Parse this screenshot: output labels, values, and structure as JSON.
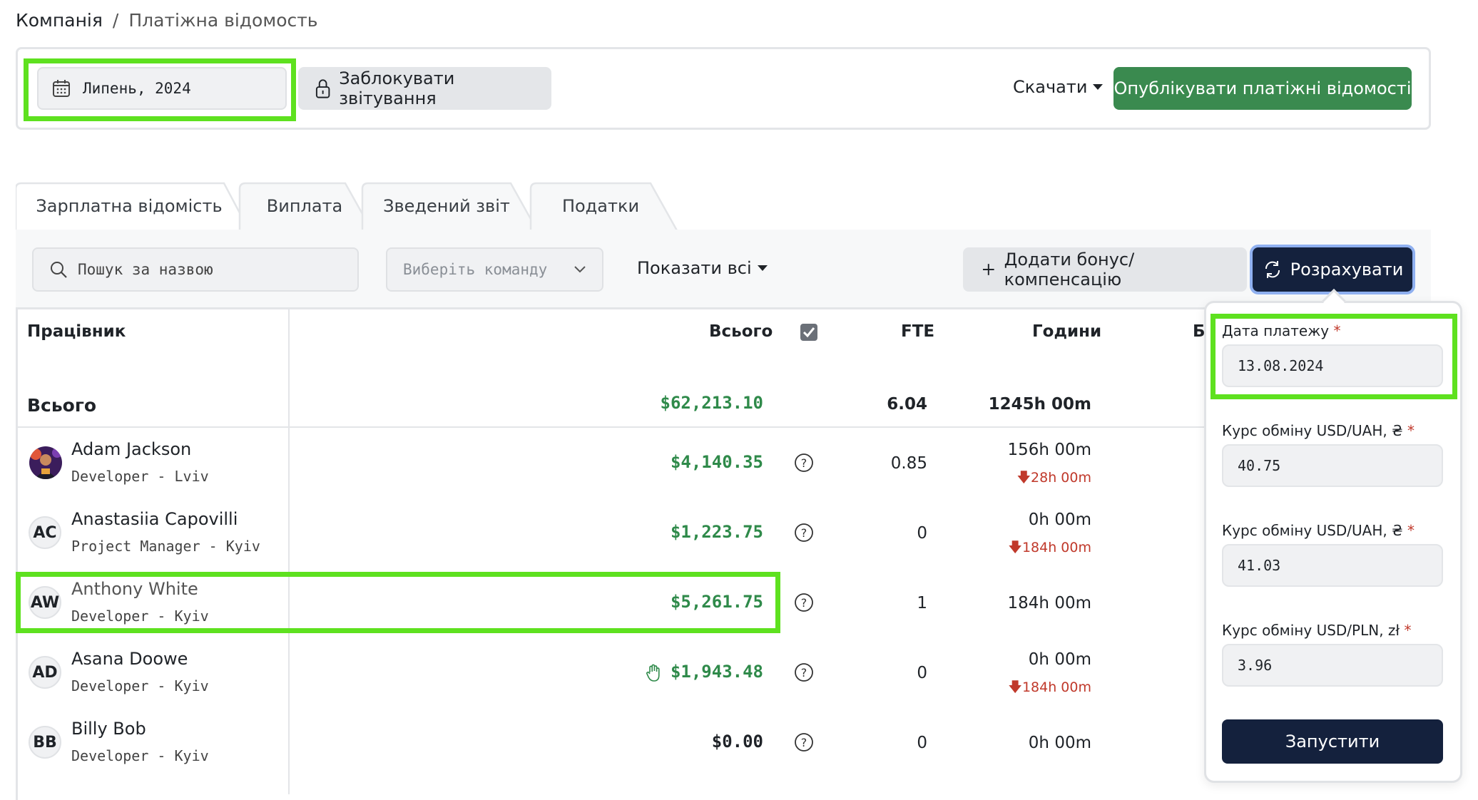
{
  "breadcrumb": {
    "root": "Компанія",
    "separator": "/",
    "current": "Платіжна відомость"
  },
  "toolbar": {
    "month": "Липень, 2024",
    "lock_label": "Заблокувати звітування",
    "download_label": "Скачати",
    "publish_label": "Опублікувати платіжні відомості"
  },
  "tabs": [
    {
      "label": "Зарплатна відомість",
      "active": true
    },
    {
      "label": "Виплата",
      "active": false
    },
    {
      "label": "Зведений звіт",
      "active": false
    },
    {
      "label": "Податки",
      "active": false
    }
  ],
  "filters": {
    "search_placeholder": "Пошук за назвою",
    "team_placeholder": "Виберіть команду",
    "show_all_label": "Показати всі",
    "bonus_label": "Додати бонус/компенсацію",
    "calculate_label": "Розрахувати"
  },
  "table": {
    "headers": {
      "employee": "Працівник",
      "total": "Всього",
      "fte": "FTE",
      "hours": "Години",
      "partial": "Б"
    },
    "totals": {
      "label": "Всього",
      "total": "$62,213.10",
      "fte": "6.04",
      "hours": "1245h 00m"
    },
    "rows": [
      {
        "initials": "",
        "name": "Adam Jackson",
        "role": "Developer - Lviv",
        "total": "$4,140.35",
        "fte": "0.85",
        "hours": "156h 00m",
        "deficit": "28h 00m",
        "has_photo": true
      },
      {
        "initials": "AC",
        "name": "Anastasiia Capovilli",
        "role": "Project Manager - Kyiv",
        "total": "$1,223.75",
        "fte": "0",
        "hours": "0h 00m",
        "deficit": "184h 00m"
      },
      {
        "initials": "AW",
        "name": "Anthony White",
        "role": "Developer - Kyiv",
        "total": "$5,261.75",
        "fte": "1",
        "hours": "184h 00m",
        "deficit": ""
      },
      {
        "initials": "AD",
        "name": "Asana Doowe",
        "role": "Developer - Kyiv",
        "total": "$1,943.48",
        "fte": "0",
        "hours": "0h 00m",
        "deficit": "184h 00m",
        "manual": true
      },
      {
        "initials": "BB",
        "name": "Billy Bob",
        "role": "Developer - Kyiv",
        "total": "$0.00",
        "fte": "0",
        "hours": "0h 00m",
        "deficit": ""
      }
    ]
  },
  "popover": {
    "payment_date_label": "Дата платежу",
    "payment_date": "13.08.2024",
    "rate1_label": "Курс обміну USD/UAH, ₴",
    "rate1": "40.75",
    "rate2_label": "Курс обміну USD/UAH, ₴",
    "rate2": "41.03",
    "rate3_label": "Курс обміну USD/PLN, zł",
    "rate3": "3.96",
    "required_mark": "*",
    "run_label": "Запустити"
  },
  "colors": {
    "accent_green": "#3a8a4f",
    "money_green": "#2f8a4a",
    "navy": "#14213d",
    "highlight": "#5ee11f",
    "deficit_red": "#c0392b"
  }
}
